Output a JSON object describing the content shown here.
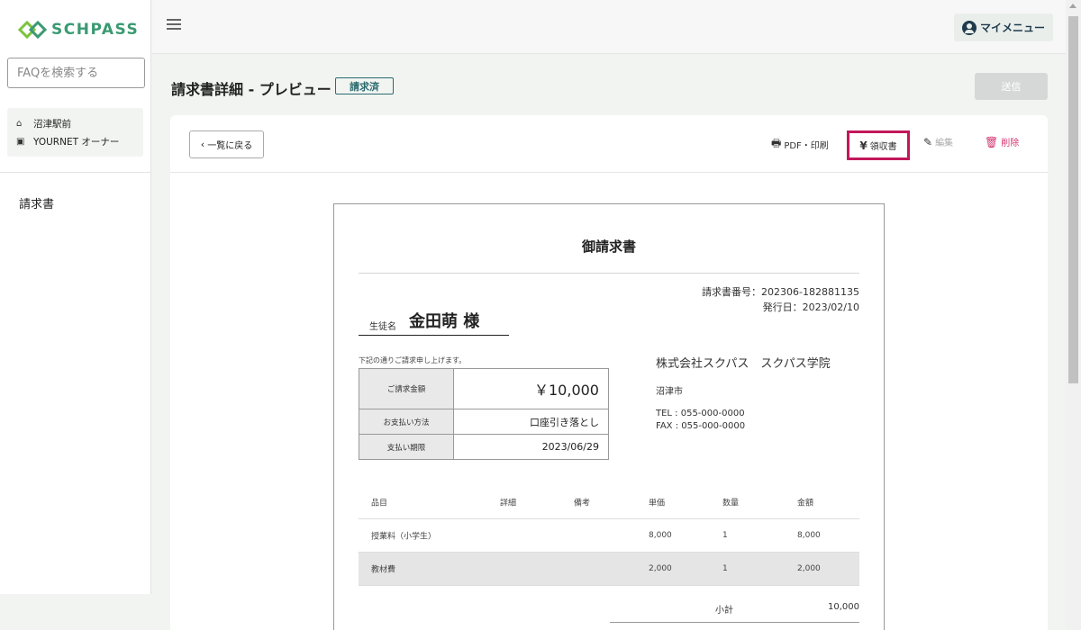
{
  "app": {
    "logo_text": "SCHPASS"
  },
  "sidebar": {
    "search_placeholder": "FAQを検索する",
    "school": [
      {
        "icon": "home-icon",
        "label": "沼津駅前"
      },
      {
        "icon": "id-card-icon",
        "label": "YOURNET オーナー"
      }
    ],
    "nav_item": "請求書"
  },
  "header": {
    "my_menu": "マイメニュー"
  },
  "page": {
    "title": "請求書詳細 - プレビュー",
    "status": "請求済",
    "send_button": "送信"
  },
  "toolbar": {
    "back": "一覧に戻る",
    "print": "PDF・印刷",
    "receipt": "領収書",
    "edit": "編集",
    "delete": "削除"
  },
  "invoice": {
    "title": "御請求書",
    "number_label": "請求書番号：",
    "number": "202306-182881135",
    "issue_label": "発行日：",
    "issue_date": "2023/02/10",
    "student_label": "生徒名",
    "student_name": "金田萌 様",
    "pretext": "下記の通りご請求申し上げます。",
    "amount_label": "ご請求金額",
    "amount": "￥10,000",
    "method_label": "お支払い方法",
    "method": "口座引き落とし",
    "due_label": "支払い期限",
    "due": "2023/06/29",
    "company": "株式会社スクパス　スクパス学院",
    "city": "沼津市",
    "tel": "TEL : 055-000-0000",
    "fax": "FAX : 055-000-0000",
    "columns": [
      "品目",
      "詳細",
      "備考",
      "単価",
      "数量",
      "金額"
    ],
    "items": [
      {
        "name": "授業料（小学生）",
        "detail": "",
        "note": "",
        "unit": "8,000",
        "qty": "1",
        "amount": "8,000"
      },
      {
        "name": "教材費",
        "detail": "",
        "note": "",
        "unit": "2,000",
        "qty": "1",
        "amount": "2,000"
      }
    ],
    "subtotal_label": "小計",
    "subtotal": "10,000"
  },
  "colors": {
    "brand": "#3a9a72",
    "badge": "#2a6b6f",
    "highlight": "#c2185b",
    "delete": "#d2336f"
  }
}
